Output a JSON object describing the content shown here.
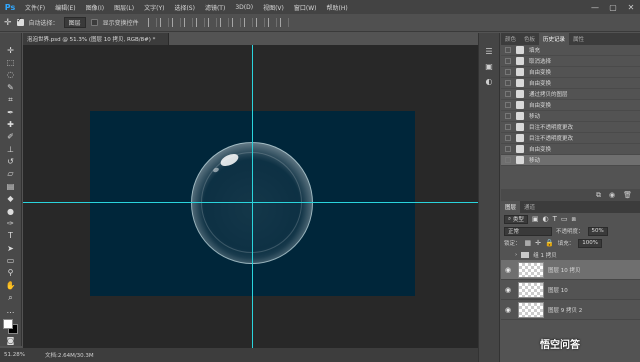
{
  "app": {
    "logo": "Ps"
  },
  "menu": {
    "items": [
      "文件(F)",
      "编辑(E)",
      "图像(I)",
      "图层(L)",
      "文字(Y)",
      "选择(S)",
      "滤镜(T)",
      "3D(D)",
      "视图(V)",
      "窗口(W)",
      "帮助(H)"
    ]
  },
  "window_controls": {
    "minimize": "—",
    "maximize": "▢",
    "close": "✕"
  },
  "options": {
    "auto_select_label": "自动选择：",
    "auto_select_value": "图层",
    "show_transform_label": "显示变换控件"
  },
  "document": {
    "tab_title": "泡泡世界.psd @ 51.3% (图层 10 拷贝, RGB/8#) *",
    "close": "×"
  },
  "status": {
    "zoom": "51.28%",
    "doc_info": "文档:2.64M/30.3M"
  },
  "panel_tabs": [
    "颜色",
    "色板",
    "历史记录",
    "属性"
  ],
  "history": {
    "items": [
      "填充",
      "取消选择",
      "自由变换",
      "自由变换",
      "通过拷贝的图层",
      "自由变换",
      "移动",
      "目注不透明度更改",
      "目注不透明度更改",
      "自由变换",
      "移动"
    ],
    "selected_index": 10
  },
  "layers_tabs": [
    "图层",
    "通道"
  ],
  "layers": {
    "filter_label": "类型",
    "blend_mode": "正常",
    "opacity_label": "不透明度：",
    "opacity_value": "50%",
    "lock_label": "锁定：",
    "fill_label": "填充：",
    "fill_value": "100%",
    "group_name": "组 1 拷贝",
    "rows": [
      {
        "name": "图层 10 拷贝",
        "selected": true
      },
      {
        "name": "图层 10",
        "selected": false
      },
      {
        "name": "图层 9 拷贝 2",
        "selected": false
      }
    ]
  },
  "watermark": "悟空问答",
  "colors": {
    "canvas": "#00263a",
    "guide": "#2ad4dc",
    "workspace": "#282828",
    "ui_dark": "#434343",
    "ui_mid": "#535353"
  }
}
